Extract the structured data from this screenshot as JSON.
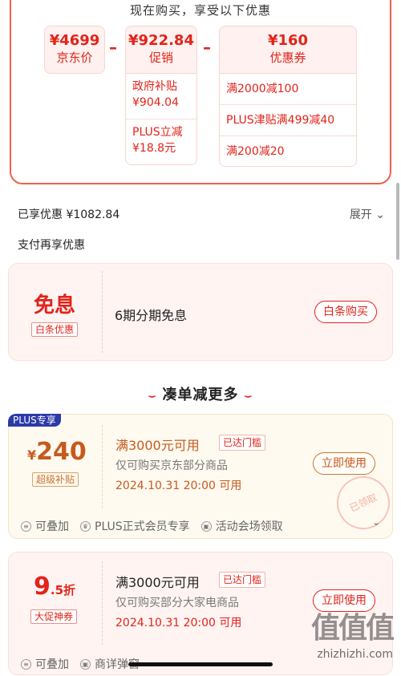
{
  "breakdown": {
    "heading": "现在购买，享受以下优惠",
    "jd_price": {
      "amount": "¥4699",
      "label": "京东价"
    },
    "promo": {
      "amount": "¥922.84",
      "label": "促销",
      "items": [
        "政府补贴\n¥904.04",
        "PLUS立减\n¥18.8元"
      ]
    },
    "coupon": {
      "amount": "¥160",
      "label": "优惠券",
      "items": [
        "满2000减100",
        "PLUS津贴满499减40",
        "满200减20"
      ]
    },
    "minus_sign": "–"
  },
  "summary": {
    "enjoyed_label": "已享优惠 ¥1082.84",
    "expand_label": "展开",
    "pay_more_label": "支付再享优惠"
  },
  "baitiao": {
    "big_text": "免息",
    "tag": "白条优惠",
    "desc": "6期分期免息",
    "button": "白条购买"
  },
  "section": {
    "title": "凑单减更多",
    "deco_left": "⌣",
    "deco_right": "⌣"
  },
  "coupon1": {
    "corner": "PLUS专享",
    "currency": "¥",
    "amount": "240",
    "tag": "超级补贴",
    "title": "满3000元可用",
    "met": "已达门槛",
    "desc": "仅可购买京东部分商品",
    "date": "2024.10.31 20:00 可用",
    "button": "立即使用",
    "stamp": "已领取",
    "footer": [
      "可叠加",
      "PLUS正式会员专享",
      "活动会场领取"
    ],
    "chevron": "⌄"
  },
  "coupon2": {
    "amount_int": "9",
    "amount_dec": ".5折",
    "tag": "大促神券",
    "title": "满3000元可用",
    "met": "已达门槛",
    "desc": "仅可购买部分大家电商品",
    "date": "2024.10.31 20:00 可用",
    "button": "立即使用",
    "footer": [
      "可叠加",
      "商详弹窗"
    ]
  },
  "watermark": {
    "logo": "值值值",
    "url": "zhizhizhi.com"
  }
}
